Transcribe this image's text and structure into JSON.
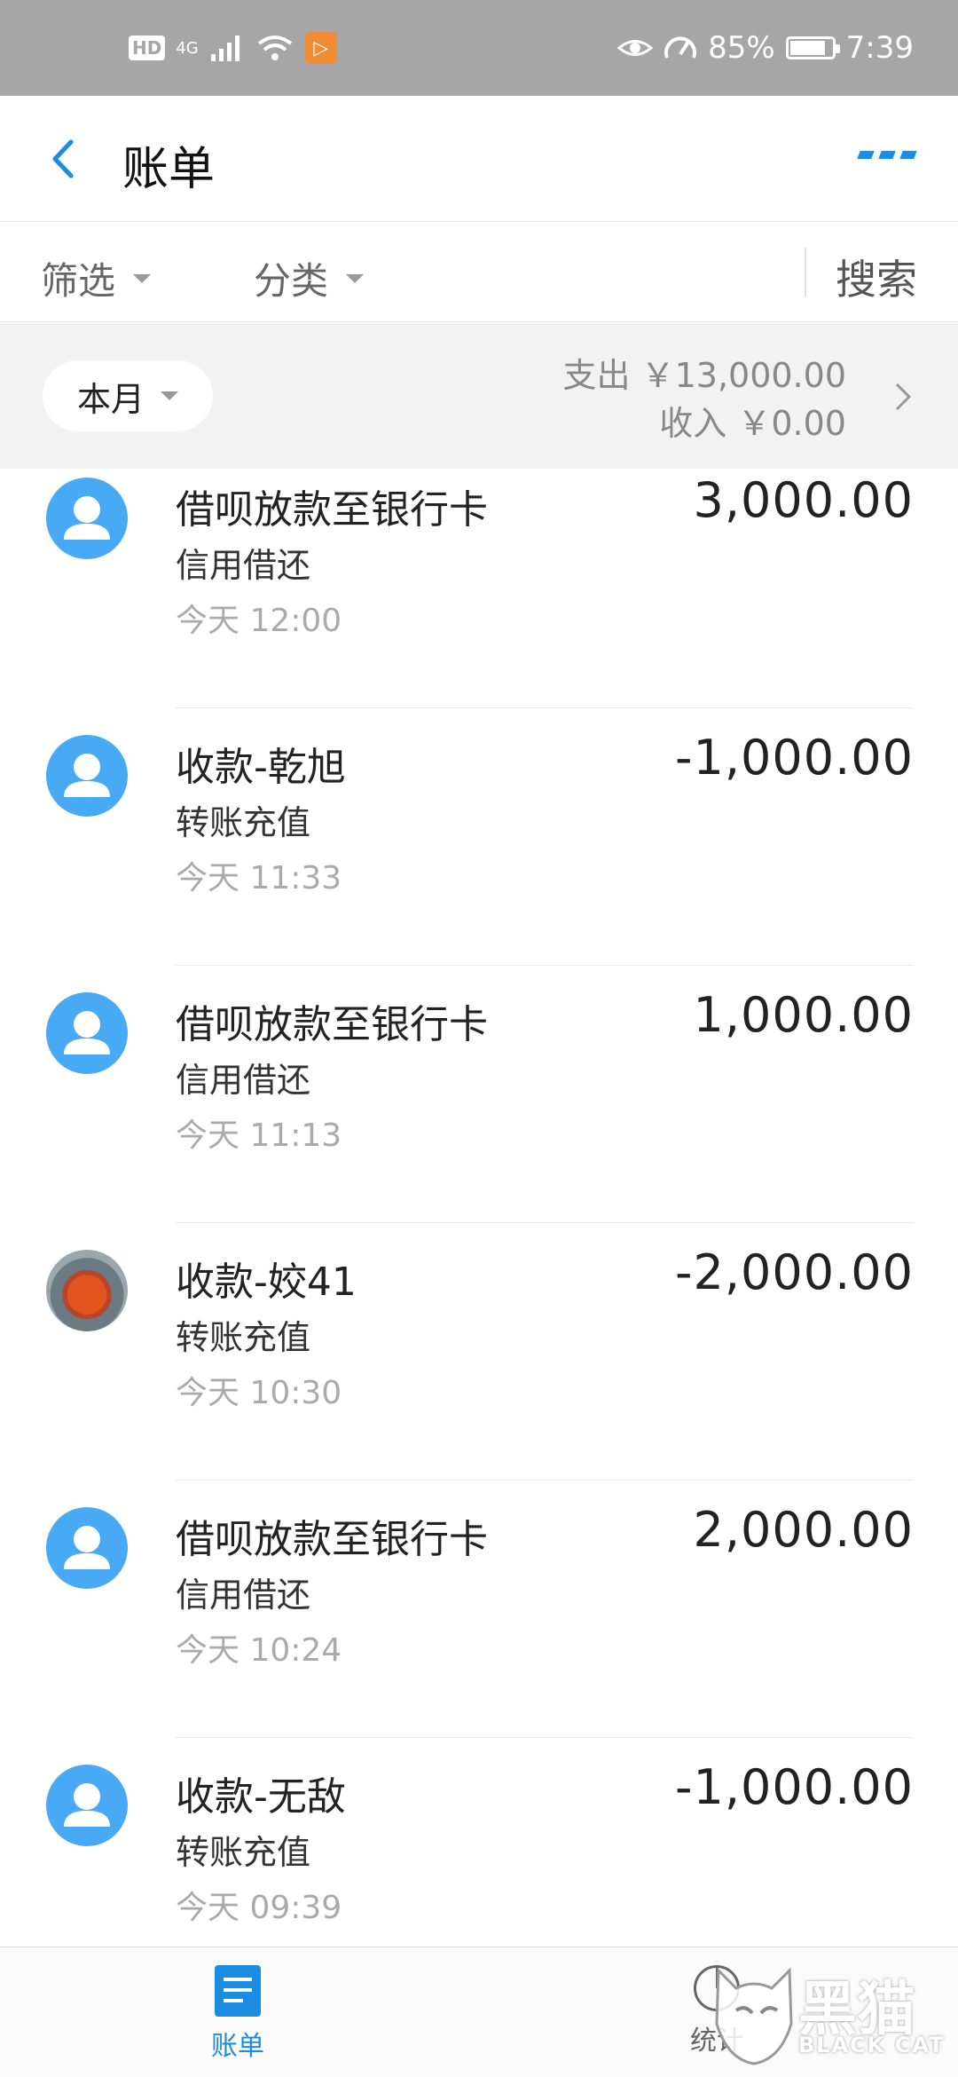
{
  "status_bar": {
    "network_label": "4G",
    "battery_percent": "85%",
    "battery_level": 0.85,
    "time": "7:39"
  },
  "header": {
    "title": "账单"
  },
  "filters": {
    "filter_label": "筛选",
    "category_label": "分类",
    "search_label": "搜索"
  },
  "month_bar": {
    "month_label": "本月",
    "expense_label": "支出 ￥13,000.00",
    "income_label": "收入 ￥0.00"
  },
  "transactions": [
    {
      "title": "借呗放款至银行卡",
      "category": "信用借还",
      "time": "今天  12:00",
      "amount": "3,000.00",
      "avatar": "user-icon"
    },
    {
      "title": "收款-乾旭",
      "category": "转账充值",
      "time": "今天  11:33",
      "amount": "-1,000.00",
      "avatar": "user-icon"
    },
    {
      "title": "借呗放款至银行卡",
      "category": "信用借还",
      "time": "今天  11:13",
      "amount": "1,000.00",
      "avatar": "user-icon"
    },
    {
      "title": "收款-姣41",
      "category": "转账充值",
      "time": "今天  10:30",
      "amount": "-2,000.00",
      "avatar": "photo"
    },
    {
      "title": "借呗放款至银行卡",
      "category": "信用借还",
      "time": "今天  10:24",
      "amount": "2,000.00",
      "avatar": "user-icon"
    },
    {
      "title": "收款-无敌",
      "category": "转账充值",
      "time": "今天  09:39",
      "amount": "-1,000.00",
      "avatar": "user-icon"
    }
  ],
  "tab_bar": {
    "bills_label": "账单",
    "stats_label": "统计"
  },
  "watermark": {
    "cn": "黑猫",
    "en": "BLACK CAT"
  },
  "colors": {
    "accent": "#1a8ce2",
    "avatar_blue": "#48a9f4",
    "status_bar": "#a6a6a6"
  }
}
